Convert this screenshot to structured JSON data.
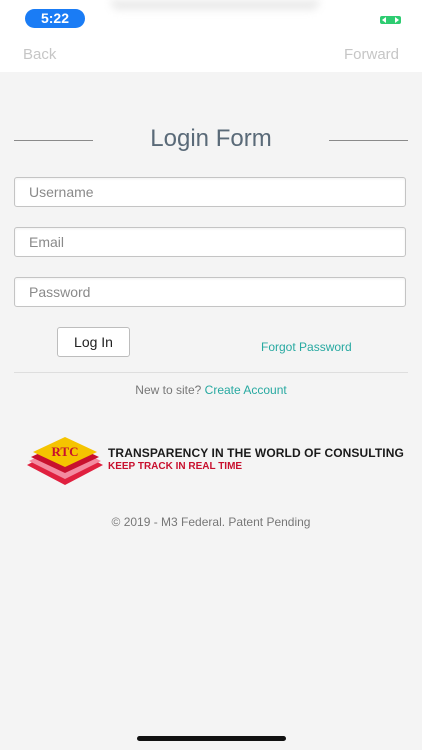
{
  "status_bar": {
    "time": "5:22"
  },
  "nav": {
    "back_label": "Back",
    "forward_label": "Forward"
  },
  "form": {
    "title": "Login Form",
    "username_placeholder": "Username",
    "email_placeholder": "Email",
    "password_placeholder": "Password",
    "login_button_label": "Log In",
    "forgot_password_label": "Forgot Password",
    "new_to_site_text": "New to site?",
    "create_account_label": "Create Account"
  },
  "logo": {
    "mark_text": "RTC",
    "tagline_1": "TRANSPARENCY IN THE WORLD OF CONSULTING",
    "tagline_2": "KEEP TRACK IN REAL TIME"
  },
  "footer": {
    "copyright": "© 2019 - M3 Federal. Patent Pending"
  },
  "colors": {
    "accent_link": "#27a9a1",
    "time_pill": "#1a7cf5",
    "logo_red": "#c8102e",
    "logo_yellow": "#f5c400"
  }
}
